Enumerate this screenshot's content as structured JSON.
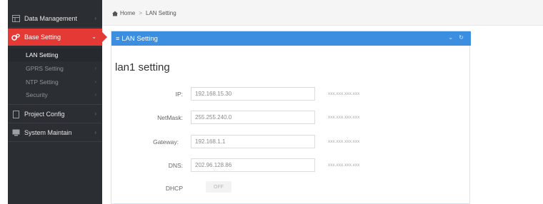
{
  "sidebar": {
    "items": [
      {
        "label": "Data Management",
        "icon": "table-icon"
      },
      {
        "label": "Base Setting",
        "icon": "cogs-icon"
      },
      {
        "label": "Project Config",
        "icon": "file-icon"
      },
      {
        "label": "System Maintain",
        "icon": "monitor-icon"
      }
    ],
    "sub_items": [
      {
        "label": "LAN Setting"
      },
      {
        "label": "GPRS Setting"
      },
      {
        "label": "NTP Setting"
      },
      {
        "label": "Security"
      }
    ],
    "chevron": "›",
    "chevron_open": "⌄"
  },
  "breadcrumb": {
    "home": "Home",
    "separator": ">",
    "current": "LAN Setting"
  },
  "panel": {
    "header": "LAN Setting",
    "tools": "⌄ ↻",
    "title": "lan1 setting"
  },
  "form": {
    "ip": {
      "label": "IP:",
      "value": "192.168.15.30",
      "hint": "xxx.xxx.xxx.xxx"
    },
    "netmask": {
      "label": "NetMask:",
      "value": "255.255.240.0",
      "hint": "xxx.xxx.xxx.xxx"
    },
    "gateway": {
      "label": "Gateway:",
      "value": "192.168.1.1",
      "hint": "xxx.xxx.xxx.xxx"
    },
    "dns": {
      "label": "DNS:",
      "value": "202.96.128.86",
      "hint": "xxx.xxx.xxx.xxx"
    },
    "dhcp": {
      "label": "DHCP",
      "value": "OFF"
    }
  },
  "colors": {
    "accent": "#3c8ee0",
    "active": "#e53935",
    "sidebar": "#2b2e33"
  }
}
